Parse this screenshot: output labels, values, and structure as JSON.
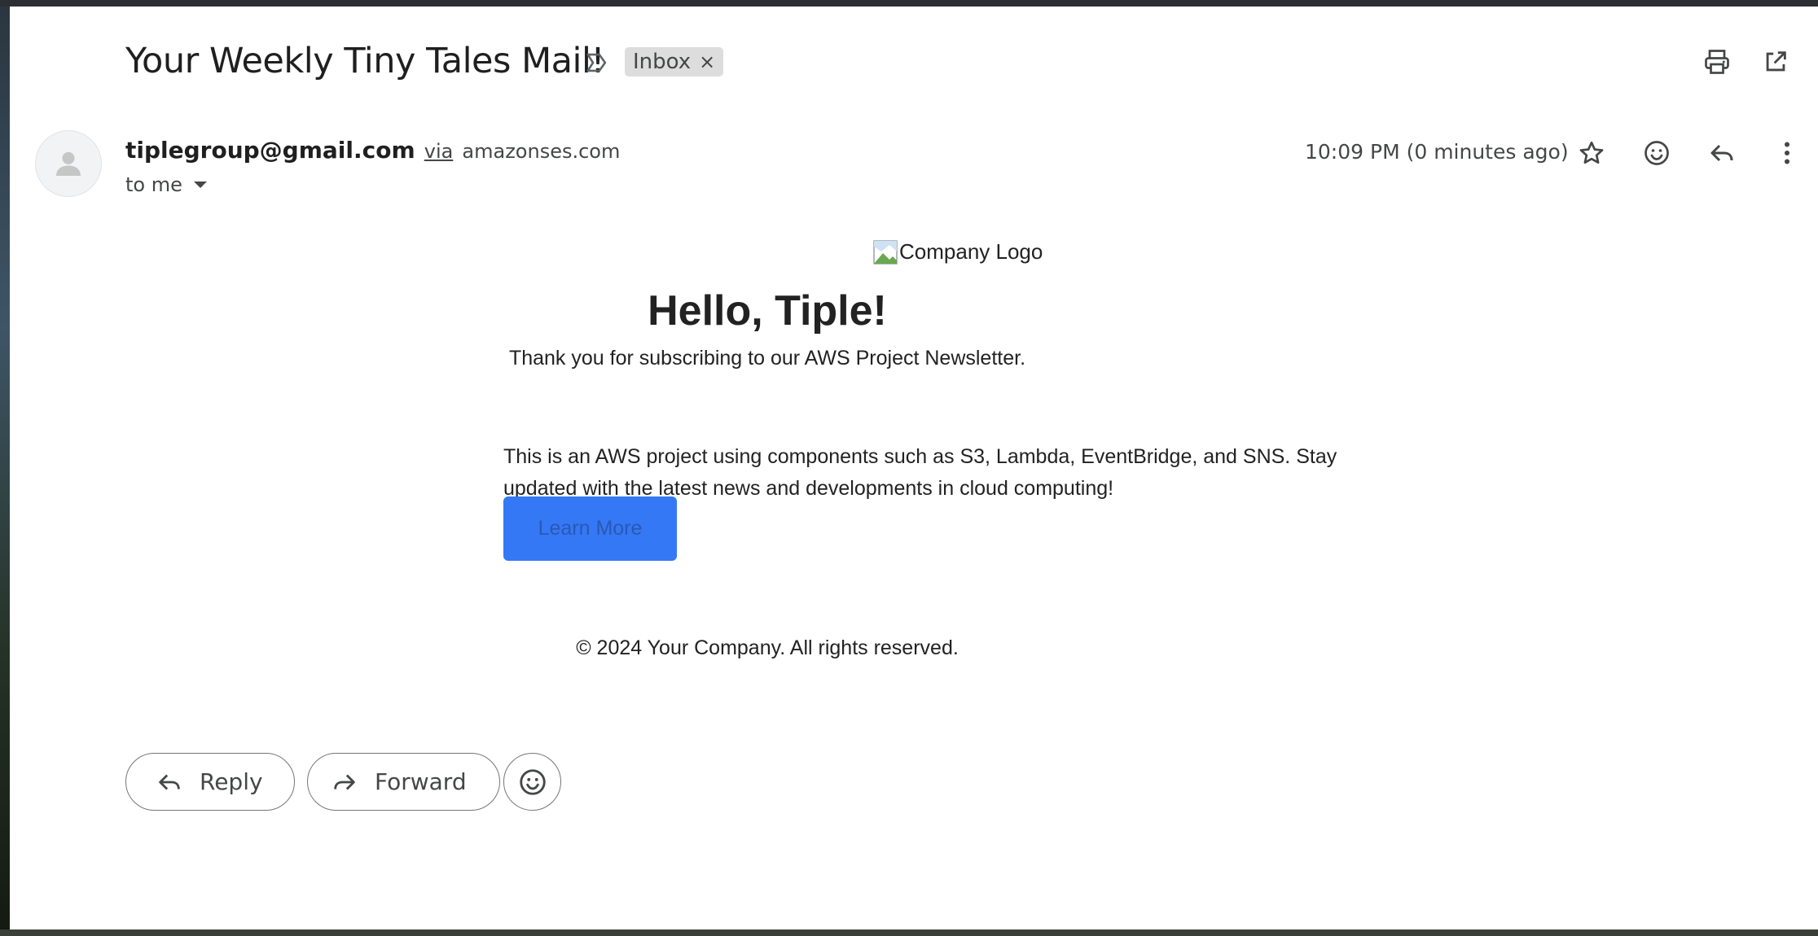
{
  "email": {
    "subject": "Your Weekly Tiny Tales Mail!",
    "label_chip": "Inbox",
    "label_remove": "×",
    "sender_email": "tiplegroup@gmail.com",
    "via_label": "via",
    "via_domain": "amazonses.com",
    "recipient_line": "to me",
    "timestamp": "10:09 PM (0 minutes ago)"
  },
  "message_body": {
    "logo_alt": "Company Logo",
    "greeting": "Hello, Tiple!",
    "thanks_line": "Thank you for subscribing to our AWS Project Newsletter.",
    "paragraph": "This is an AWS project using components such as S3, Lambda, EventBridge, and SNS. Stay updated with the latest news and developments in cloud computing!",
    "cta_label": "Learn More",
    "footer": "© 2024 Your Company. All rights reserved."
  },
  "actions": {
    "reply_label": "Reply",
    "forward_label": "Forward"
  },
  "icons": {
    "importance": "label-importance-icon",
    "print": "print-icon",
    "open_new_window": "open-in-new-icon",
    "star": "star-icon",
    "emoji": "emoji-icon",
    "reply": "reply-icon",
    "more": "more-vert-icon",
    "forward": "forward-icon"
  },
  "colors": {
    "cta_background": "#3478f6",
    "chip_background": "#dddddd",
    "text_primary": "#1f1f1f",
    "text_secondary": "#444746"
  }
}
